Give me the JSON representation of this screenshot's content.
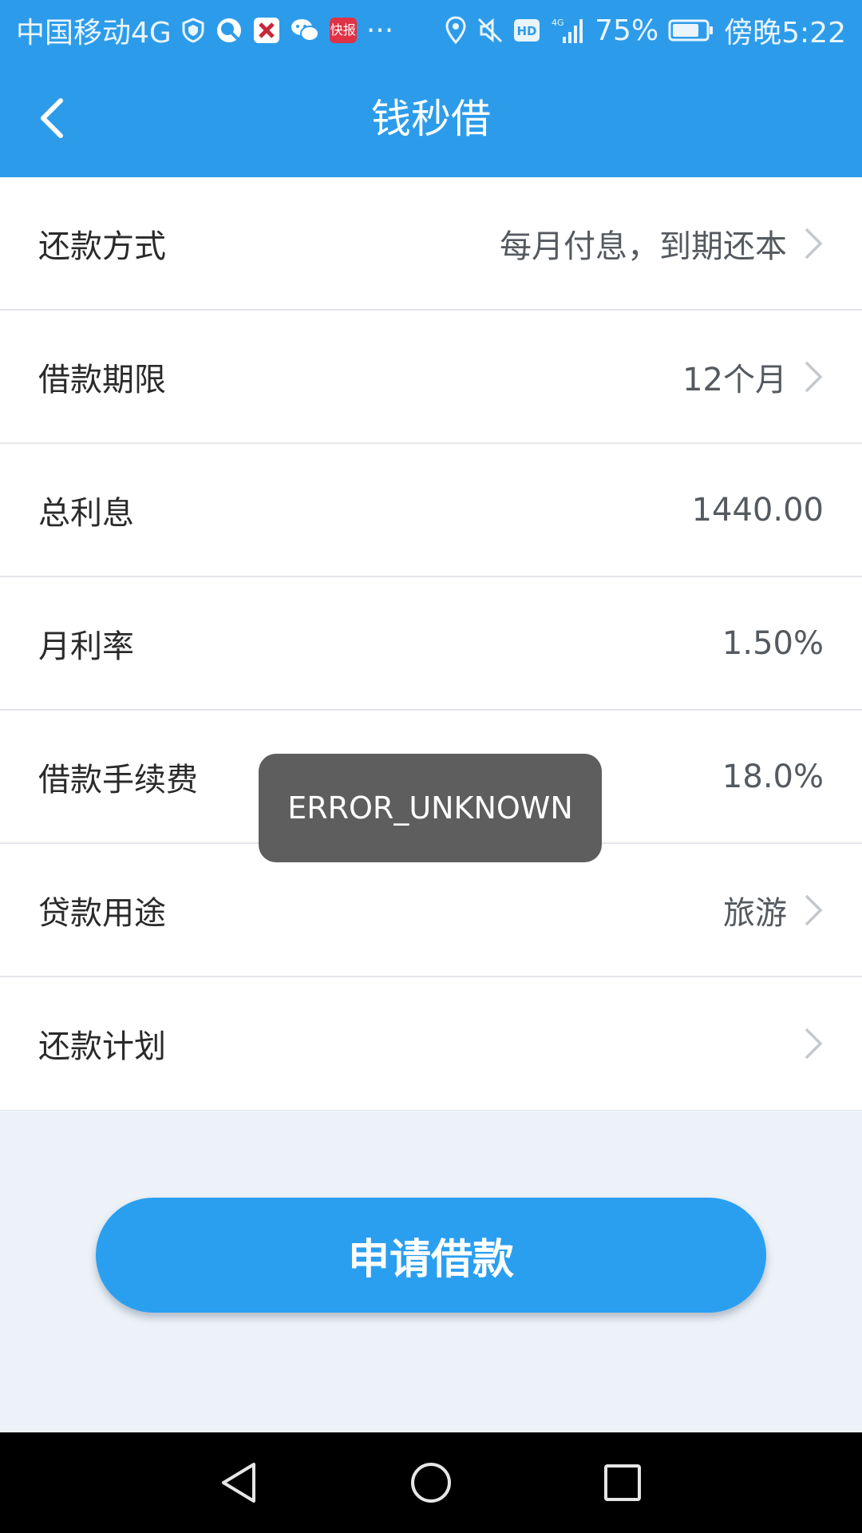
{
  "status_bar": {
    "carrier": "中国移动4G",
    "badge_news": "快报",
    "more": "···",
    "network": "4G",
    "battery": "75%",
    "time": "傍晚5:22"
  },
  "nav": {
    "title": "钱秒借"
  },
  "rows": [
    {
      "label": "还款方式",
      "value": "每月付息，到期还本",
      "chevron": true
    },
    {
      "label": "借款期限",
      "value": "12个月",
      "chevron": true
    },
    {
      "label": "总利息",
      "value": "1440.00",
      "chevron": false
    },
    {
      "label": "月利率",
      "value": "1.50%",
      "chevron": false
    },
    {
      "label": "借款手续费",
      "value": "18.0%",
      "chevron": false
    },
    {
      "label": "贷款用途",
      "value": "旅游",
      "chevron": true
    },
    {
      "label": "还款计划",
      "value": "",
      "chevron": true
    }
  ],
  "apply_button": {
    "label": "申请借款"
  },
  "toast": {
    "message": "ERROR_UNKNOWN"
  },
  "colors": {
    "primary": "#2c9cea",
    "button": "#2a9ff0",
    "background": "#edf2f8",
    "toast": "#555555"
  },
  "icons": {
    "back": "chevron-left-icon",
    "row_arrow": "chevron-right-icon",
    "nav_back": "triangle-back-icon",
    "nav_home": "circle-home-icon",
    "nav_recent": "square-recent-icon"
  }
}
